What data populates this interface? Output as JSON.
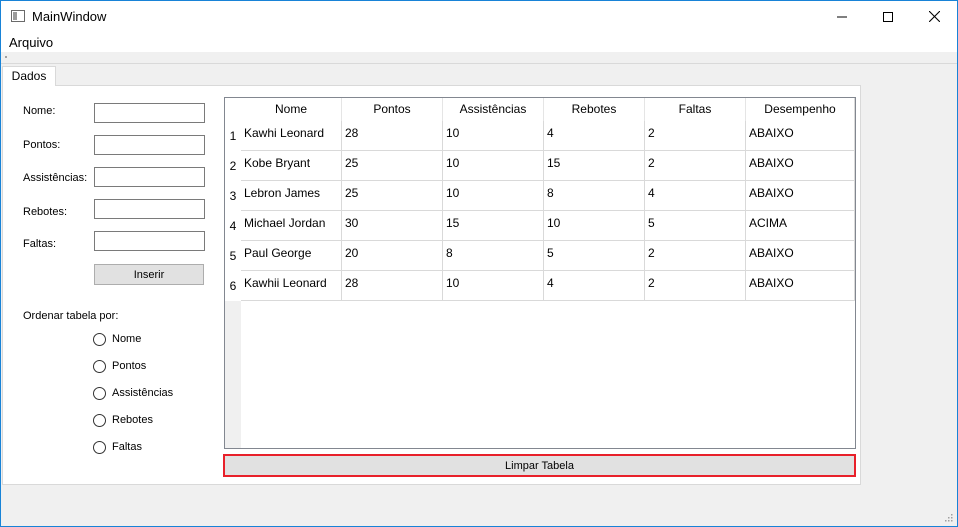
{
  "window": {
    "title": "MainWindow",
    "icon": "app-window-icon",
    "controls": [
      "minimize-icon",
      "maximize-icon",
      "close-icon"
    ]
  },
  "menu": {
    "items": [
      {
        "label": "Arquivo"
      }
    ]
  },
  "tabs": [
    {
      "label": "Dados",
      "active": true
    }
  ],
  "form": {
    "fields": [
      {
        "label": "Nome:",
        "value": ""
      },
      {
        "label": "Pontos:",
        "value": ""
      },
      {
        "label": "Assistências:",
        "value": ""
      },
      {
        "label": "Rebotes:",
        "value": ""
      },
      {
        "label": "Faltas:",
        "value": ""
      }
    ],
    "insert_button": "Inserir"
  },
  "sort": {
    "label": "Ordenar tabela por:",
    "options": [
      {
        "label": "Nome",
        "checked": false
      },
      {
        "label": "Pontos",
        "checked": false
      },
      {
        "label": "Assistências",
        "checked": false
      },
      {
        "label": "Rebotes",
        "checked": false
      },
      {
        "label": "Faltas",
        "checked": false
      }
    ]
  },
  "table": {
    "headers": [
      "Nome",
      "Pontos",
      "Assistências",
      "Rebotes",
      "Faltas",
      "Desempenho"
    ],
    "rows": [
      {
        "num": "1",
        "cells": [
          "Kawhi Leonard",
          "28",
          "10",
          "4",
          "2",
          "ABAIXO"
        ]
      },
      {
        "num": "2",
        "cells": [
          "Kobe Bryant",
          "25",
          "10",
          "15",
          "2",
          "ABAIXO"
        ]
      },
      {
        "num": "3",
        "cells": [
          "Lebron James",
          "25",
          "10",
          "8",
          "4",
          "ABAIXO"
        ]
      },
      {
        "num": "4",
        "cells": [
          "Michael Jordan",
          "30",
          "15",
          "10",
          "5",
          "ACIMA"
        ]
      },
      {
        "num": "5",
        "cells": [
          "Paul George",
          "20",
          "8",
          "5",
          "2",
          "ABAIXO"
        ]
      },
      {
        "num": "6",
        "cells": [
          "Kawhii Leonard",
          "28",
          "10",
          "4",
          "2",
          "ABAIXO"
        ]
      }
    ]
  },
  "clear_button": "Limpar Tabela",
  "colors": {
    "window_border": "#1883d7",
    "highlight_border": "#e8202a",
    "button_face": "#e1e1e1"
  }
}
